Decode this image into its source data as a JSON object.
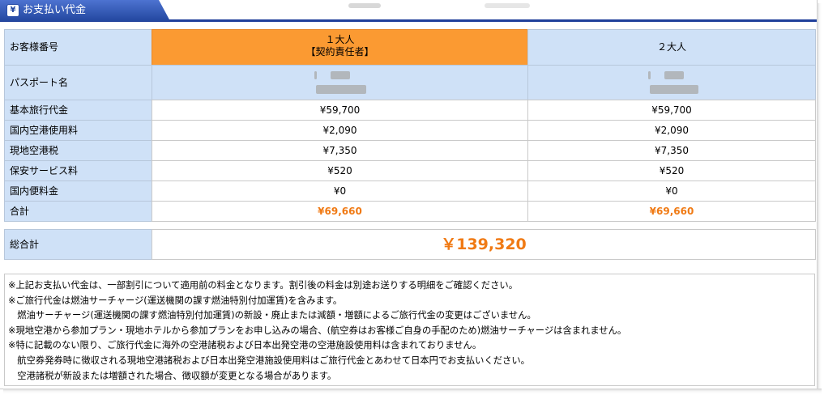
{
  "header": {
    "title": "お支払い代金",
    "icon": "yen-icon"
  },
  "table": {
    "row_label_header": "お客様番号",
    "passenger_1": {
      "number": "１大人",
      "role": "【契約責任者】"
    },
    "passenger_2": {
      "number": "２大人"
    },
    "passport_label": "パスポート名",
    "rows": [
      {
        "label": "基本旅行代金",
        "p1": "¥59,700",
        "p2": "¥59,700"
      },
      {
        "label": "国内空港使用料",
        "p1": "¥2,090",
        "p2": "¥2,090"
      },
      {
        "label": "現地空港税",
        "p1": "¥7,350",
        "p2": "¥7,350"
      },
      {
        "label": "保安サービス料",
        "p1": "¥520",
        "p2": "¥520"
      },
      {
        "label": "国内便料金",
        "p1": "¥0",
        "p2": "¥0"
      }
    ],
    "subtotal": {
      "label": "合計",
      "p1": "¥69,660",
      "p2": "¥69,660"
    },
    "grand_total": {
      "label": "総合計",
      "value": "￥139,320"
    }
  },
  "notes": [
    "※上記お支払い代金は、一部割引について適用前の料金となります。割引後の料金は別途お送りする明細をご確認ください。",
    "※ご旅行代金は燃油サーチャージ(運送機関の課す燃油特別付加運賃)を含みます。",
    "　燃油サーチャージ(運送機関の課す燃油特別付加運賃)の新設・廃止または減額・増額によるご旅行代金の変更はございません。",
    "※現地空港から参加プラン・現地ホテルから参加プランをお申し込みの場合、(航空券はお客様ご自身の手配のため)燃油サーチャージは含まれません。",
    "※特に記載のない限り、ご旅行代金に海外の空港諸税および日本出発空港の空港施設使用料は含まれておりません。",
    "　航空券発券時に徴収される現地空港諸税および日本出発空港施設使用料はご旅行代金とあわせて日本円でお支払いください。",
    "　空港諸税が新設または増額された場合、徴収額が変更となる場合があります。"
  ],
  "colors": {
    "label_bg": "#cfe1f7",
    "highlight": "#fb9a32",
    "total_text": "#f07a14",
    "header_blue": "#23479f"
  }
}
